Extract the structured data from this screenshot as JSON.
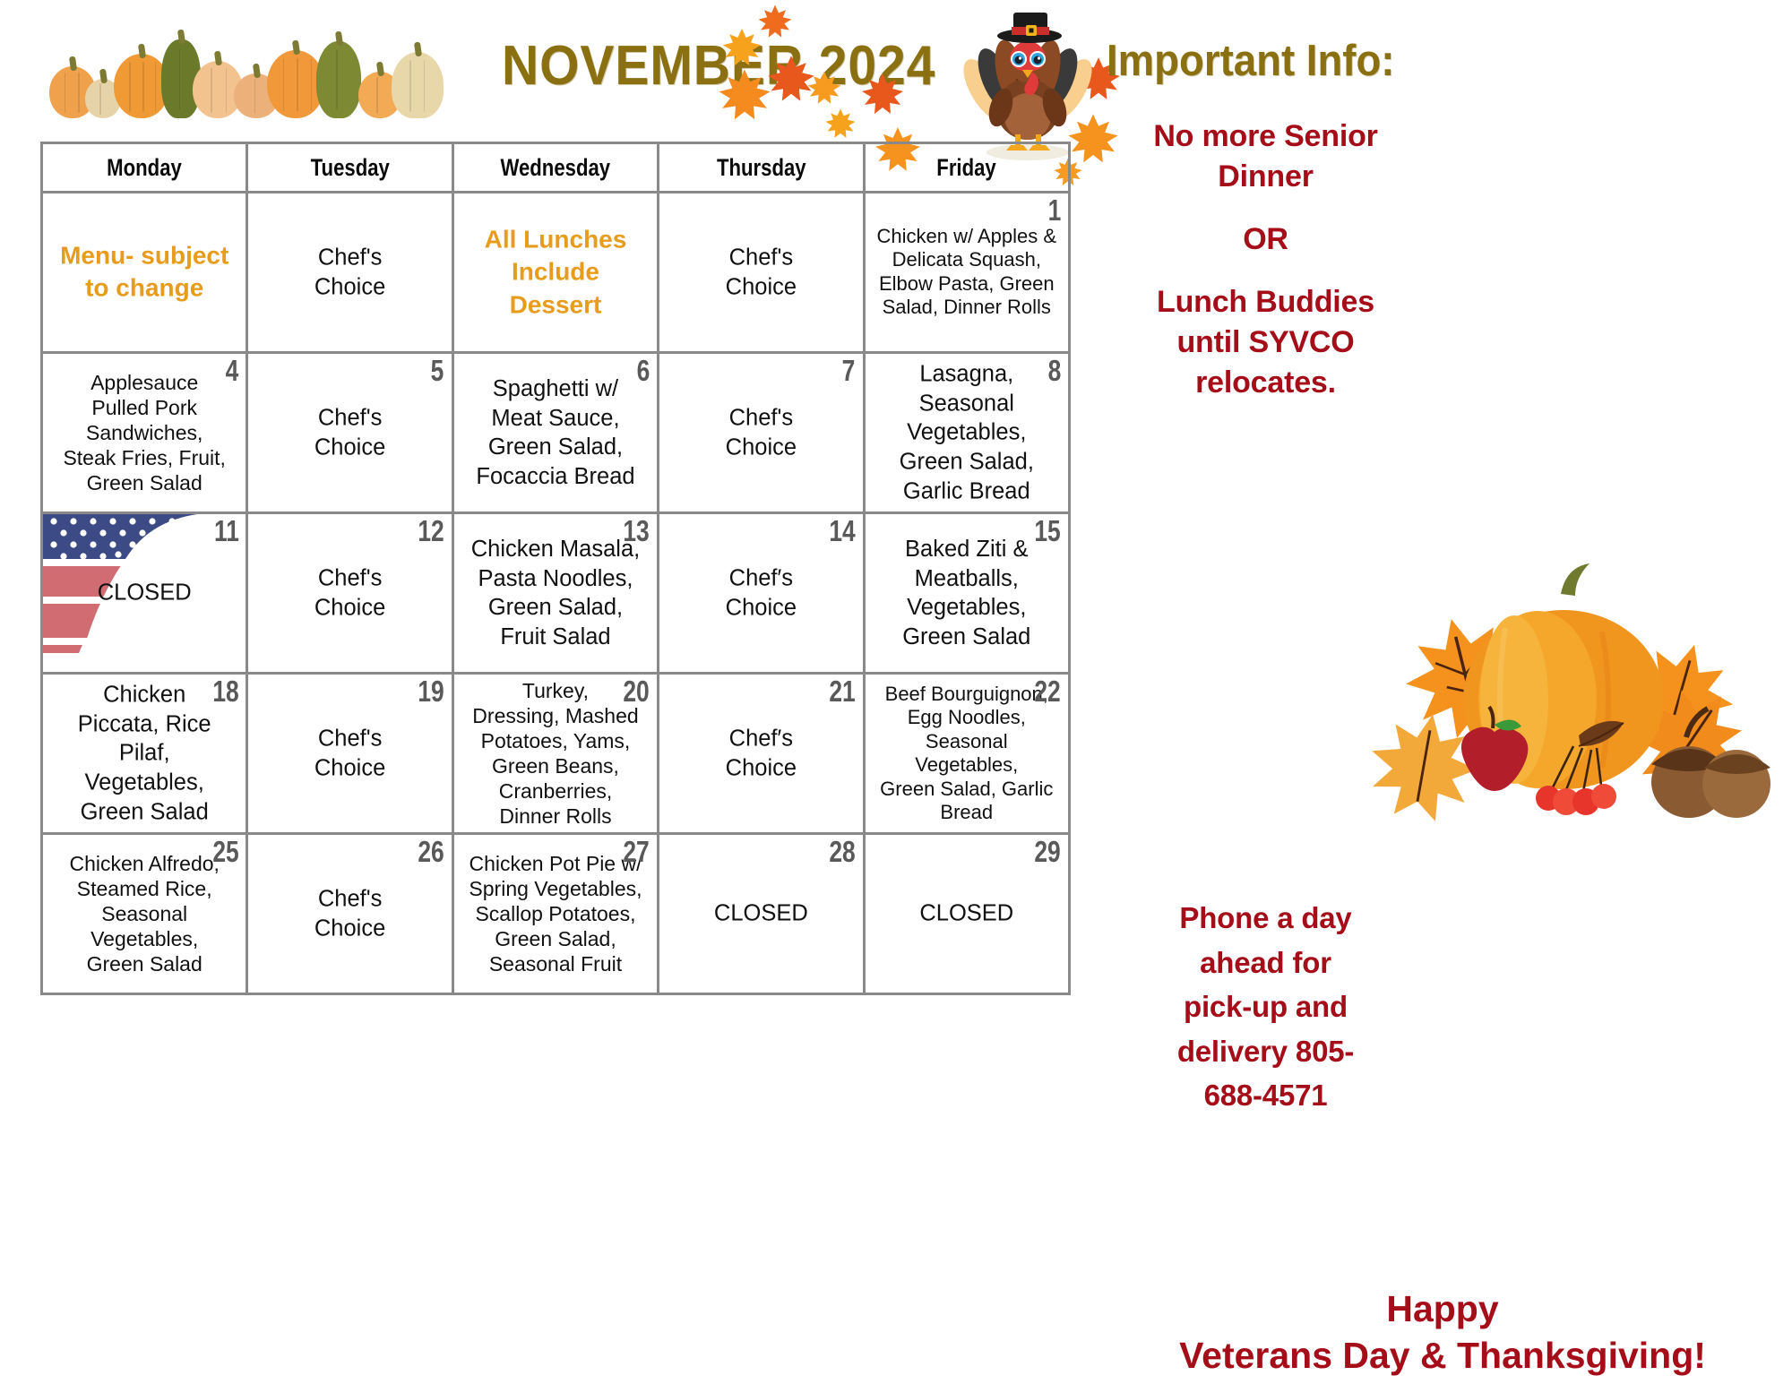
{
  "title": "NOVEMBER 2024",
  "colors": {
    "title_olive": "#8a7011",
    "accent_orange": "#e79c1d",
    "dark_red": "#a50d19",
    "daynum_gray": "#595959",
    "grid_gray": "#898989"
  },
  "calendar": {
    "day_headers": [
      "Monday",
      "Tuesday",
      "Wednesday",
      "Thursday",
      "Friday"
    ],
    "weeks": [
      [
        {
          "num": "",
          "text": "Menu- subject\nto change",
          "style": "note"
        },
        {
          "num": "",
          "text": "Chef's\nChoice",
          "style": "normal"
        },
        {
          "num": "",
          "text": "All Lunches\nInclude\nDessert",
          "style": "note"
        },
        {
          "num": "",
          "text": "Chef's\nChoice",
          "style": "normal"
        },
        {
          "num": "1",
          "text": "Chicken w/ Apples &\nDelicata Squash,\nElbow Pasta, Green\nSalad, Dinner Rolls",
          "style": "tiny"
        }
      ],
      [
        {
          "num": "4",
          "text": "Applesauce\nPulled Pork\nSandwiches,\nSteak Fries, Fruit,\nGreen Salad",
          "style": "small"
        },
        {
          "num": "5",
          "text": "Chef's\nChoice",
          "style": "normal"
        },
        {
          "num": "6",
          "text": "Spaghetti w/\nMeat Sauce,\nGreen Salad,\nFocaccia Bread",
          "style": "normal"
        },
        {
          "num": "7",
          "text": "Chef's\nChoice",
          "style": "normal"
        },
        {
          "num": "8",
          "text": "Lasagna,\nSeasonal\nVegetables,\nGreen Salad,\nGarlic Bread",
          "style": "normal"
        }
      ],
      [
        {
          "num": "11",
          "text": "CLOSED",
          "style": "normal",
          "graphic": "usa-flag"
        },
        {
          "num": "12",
          "text": "Chef's\nChoice",
          "style": "normal"
        },
        {
          "num": "13",
          "text": "Chicken Masala,\nPasta Noodles,\nGreen Salad,\nFruit Salad",
          "style": "normal"
        },
        {
          "num": "14",
          "text": "Chef′s\nChoice",
          "style": "normal"
        },
        {
          "num": "15",
          "text": "Baked Ziti &\nMeatballs,\nVegetables,\nGreen Salad",
          "style": "normal"
        }
      ],
      [
        {
          "num": "18",
          "text": "Chicken\nPiccata, Rice\nPilaf,\nVegetables,\nGreen Salad",
          "style": "normal"
        },
        {
          "num": "19",
          "text": "Chef's\nChoice",
          "style": "normal"
        },
        {
          "num": "20",
          "text": "Turkey,\nDressing, Mashed\nPotatoes, Yams,\nGreen Beans,\nCranberries,\nDinner Rolls",
          "style": "small"
        },
        {
          "num": "21",
          "text": "Chef′s\nChoice",
          "style": "normal"
        },
        {
          "num": "22",
          "text": "Beef Bourguignon,\nEgg Noodles,\nSeasonal Vegetables,\nGreen Salad, Garlic\nBread",
          "style": "tiny"
        }
      ],
      [
        {
          "num": "25",
          "text": "Chicken Alfredo,\nSteamed Rice,\nSeasonal\nVegetables,\nGreen Salad",
          "style": "small"
        },
        {
          "num": "26",
          "text": "Chef's\nChoice",
          "style": "normal"
        },
        {
          "num": "27",
          "text": "Chicken Pot Pie w/\nSpring Vegetables,\nScallop Potatoes,\nGreen Salad,\nSeasonal Fruit",
          "style": "small"
        },
        {
          "num": "28",
          "text": "CLOSED",
          "style": "normal"
        },
        {
          "num": "29",
          "text": "CLOSED",
          "style": "normal"
        }
      ]
    ]
  },
  "sidebar": {
    "heading": "Important Info:",
    "line1": "No more Senior\nDinner",
    "or": "OR",
    "line2": "Lunch Buddies\nuntil SYVCO\nrelocates.",
    "phone_note": "Phone a day\nahead for\npick-up and\ndelivery 805-\n688-4571"
  },
  "footer": {
    "greeting": "Happy\nVeterans Day & Thanksgiving!"
  },
  "graphics": {
    "top_strip": "pumpkin-gourd-row-illustration",
    "turkey": "turkey-pilgrim-illustration",
    "leaves": "falling-maple-leaves-illustration",
    "autumn": "pumpkin-apple-acorn-leaves-illustration",
    "flag": "usa-flag-illustration"
  }
}
